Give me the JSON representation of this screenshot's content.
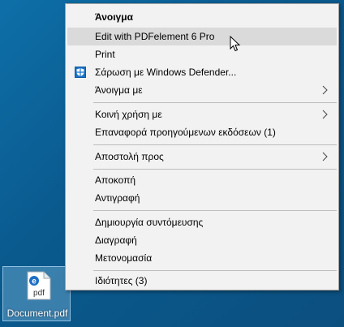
{
  "context_menu": {
    "items": [
      {
        "label": "Άνοιγμα"
      },
      {
        "label": "Edit with PDFelement 6 Pro"
      },
      {
        "label": "Print"
      },
      {
        "label": "Σάρωση με Windows Defender..."
      },
      {
        "label": "Άνοιγμα με"
      },
      {
        "label": "Κοινή χρήση με"
      },
      {
        "label": "Επαναφορά προηγούμενων εκδόσεων (1)"
      },
      {
        "label": "Αποστολή προς"
      },
      {
        "label": "Αποκοπή"
      },
      {
        "label": "Αντιγραφή"
      },
      {
        "label": "Δημιουργία συντόμευσης"
      },
      {
        "label": "Διαγραφή"
      },
      {
        "label": "Μετονομασία"
      },
      {
        "label": "Ιδιότητες (3)"
      }
    ],
    "highlighted_item": "Edit with PDFelement 6 Pro",
    "icons": {
      "defender": "windows-defender-shield-icon",
      "submenu": "chevron-right-icon"
    }
  },
  "desktop": {
    "file_name": "Document.pdf",
    "file_icon": "pdf-file-icon",
    "file_icon_text": "pdf"
  },
  "colors": {
    "menu_background": "#f2f2f2",
    "highlight": "#dadada",
    "desktop": "#0b5e93",
    "defender_blue": "#1a73c7"
  }
}
